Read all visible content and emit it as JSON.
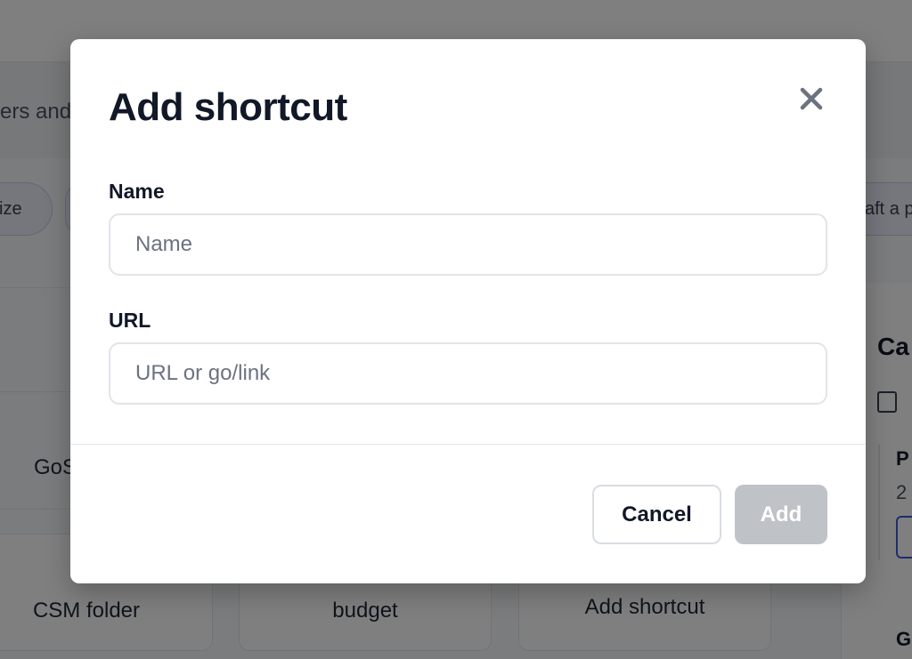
{
  "background": {
    "hero_text": "vers and",
    "chip_left": "ize",
    "chip_right": "aft a p",
    "tile_partial": "GoS",
    "tiles": [
      {
        "label": "CSM folder"
      },
      {
        "label": "budget"
      },
      {
        "label": "Add shortcut"
      }
    ],
    "side_title": "Ca",
    "side_item_title": "P",
    "side_item_sub": "2",
    "side_item_2": "G"
  },
  "modal": {
    "title": "Add shortcut",
    "close_icon": "close-icon",
    "fields": {
      "name": {
        "label": "Name",
        "value": "",
        "placeholder": "Name"
      },
      "url": {
        "label": "URL",
        "value": "",
        "placeholder": "URL or go/link"
      }
    },
    "buttons": {
      "cancel": "Cancel",
      "add": "Add"
    }
  },
  "colors": {
    "overlay": "rgba(0,0,0,0.5)",
    "add_disabled": "#bfc2c7",
    "title": "#111827",
    "close_icon": "#6b7280"
  }
}
